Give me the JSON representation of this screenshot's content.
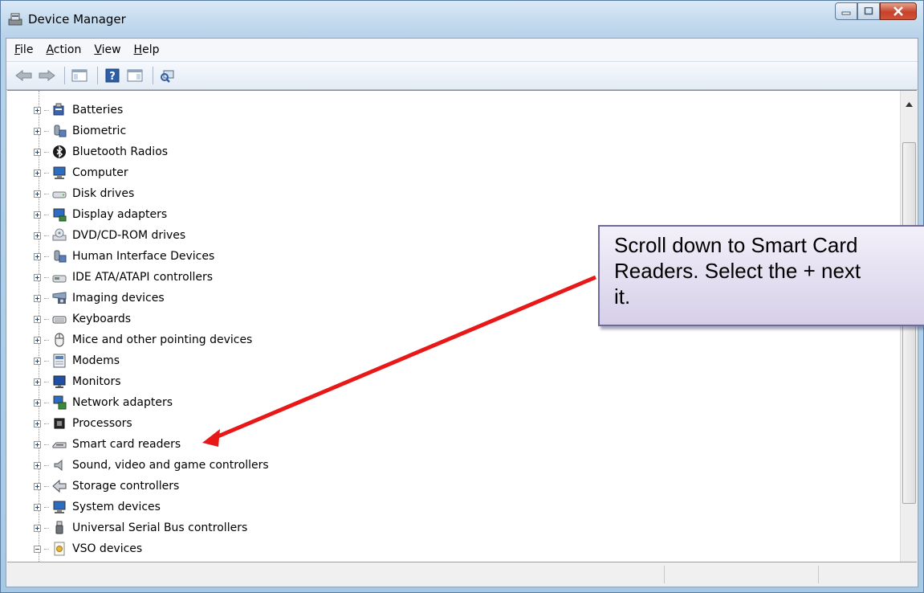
{
  "window": {
    "title": "Device Manager"
  },
  "menu": {
    "items": [
      {
        "underline": "F",
        "rest": "ile"
      },
      {
        "underline": "A",
        "rest": "ction"
      },
      {
        "underline": "V",
        "rest": "iew"
      },
      {
        "underline": "H",
        "rest": "elp"
      }
    ]
  },
  "tree": {
    "items": [
      {
        "label": "Batteries",
        "icon": "battery-icon"
      },
      {
        "label": "Biometric",
        "icon": "biometric-icon"
      },
      {
        "label": "Bluetooth Radios",
        "icon": "bluetooth-icon"
      },
      {
        "label": "Computer",
        "icon": "computer-icon"
      },
      {
        "label": "Disk drives",
        "icon": "disk-drive-icon"
      },
      {
        "label": "Display adapters",
        "icon": "display-adapter-icon"
      },
      {
        "label": "DVD/CD-ROM drives",
        "icon": "dvd-drive-icon"
      },
      {
        "label": "Human Interface Devices",
        "icon": "hid-icon"
      },
      {
        "label": "IDE ATA/ATAPI controllers",
        "icon": "ide-controller-icon"
      },
      {
        "label": "Imaging devices",
        "icon": "camera-icon"
      },
      {
        "label": "Keyboards",
        "icon": "keyboard-icon"
      },
      {
        "label": "Mice and other pointing devices",
        "icon": "mouse-icon"
      },
      {
        "label": "Modems",
        "icon": "modem-icon"
      },
      {
        "label": "Monitors",
        "icon": "monitor-icon"
      },
      {
        "label": "Network adapters",
        "icon": "network-adapter-icon"
      },
      {
        "label": "Processors",
        "icon": "processor-icon"
      },
      {
        "label": "Smart card readers",
        "icon": "smart-card-reader-icon"
      },
      {
        "label": "Sound, video and game controllers",
        "icon": "speaker-icon"
      },
      {
        "label": "Storage controllers",
        "icon": "storage-controller-icon"
      },
      {
        "label": "System devices",
        "icon": "system-device-icon"
      },
      {
        "label": "Universal Serial Bus controllers",
        "icon": "usb-icon"
      },
      {
        "label": "VSO devices",
        "icon": "vso-device-icon"
      }
    ]
  },
  "callout": {
    "text": "Scroll down to Smart Card\nReaders. Select the + next\nit."
  },
  "colors": {
    "arrow": "#e81818",
    "callout_border": "#6f6a9c"
  }
}
